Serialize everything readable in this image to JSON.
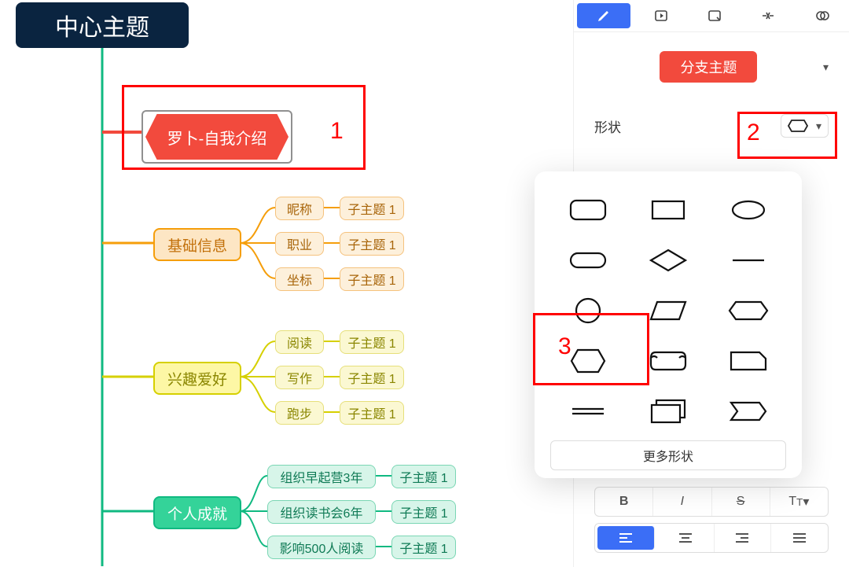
{
  "mindmap": {
    "root": "中心主题",
    "selected_node": "罗卜-自我介绍",
    "branches": [
      {
        "label": "基础信息",
        "color": "orange",
        "children": [
          {
            "label": "昵称",
            "sub": "子主题 1"
          },
          {
            "label": "职业",
            "sub": "子主题 1"
          },
          {
            "label": "坐标",
            "sub": "子主题 1"
          }
        ]
      },
      {
        "label": "兴趣爱好",
        "color": "yellow",
        "children": [
          {
            "label": "阅读",
            "sub": "子主题 1"
          },
          {
            "label": "写作",
            "sub": "子主题 1"
          },
          {
            "label": "跑步",
            "sub": "子主题 1"
          }
        ]
      },
      {
        "label": "个人成就",
        "color": "green",
        "children": [
          {
            "label": "组织早起营3年",
            "sub": "子主题 1"
          },
          {
            "label": "组织读书会6年",
            "sub": "子主题 1"
          },
          {
            "label": "影响500人阅读",
            "sub": "子主题 1"
          }
        ]
      }
    ]
  },
  "panel": {
    "tabs": [
      "style",
      "slideshow",
      "note",
      "structure",
      "filter"
    ],
    "active_tab": 0,
    "topic_type": "分支主题",
    "shape_label": "形状",
    "current_shape": "hexagon",
    "shape_options": [
      "rounded-rect",
      "rect",
      "ellipse",
      "capsule",
      "diamond",
      "line",
      "circle",
      "parallelogram",
      "hexagon-wide",
      "hexagon",
      "rounded-trap",
      "rect-notch",
      "double-line",
      "stack",
      "arrow-tag"
    ],
    "more_shapes": "更多形状",
    "text_format": [
      "bold",
      "italic",
      "strike",
      "text-style"
    ],
    "align": [
      "left",
      "center",
      "right",
      "justify"
    ],
    "active_align": 0
  },
  "annotations": {
    "n1": "1",
    "n2": "2",
    "n3": "3"
  }
}
